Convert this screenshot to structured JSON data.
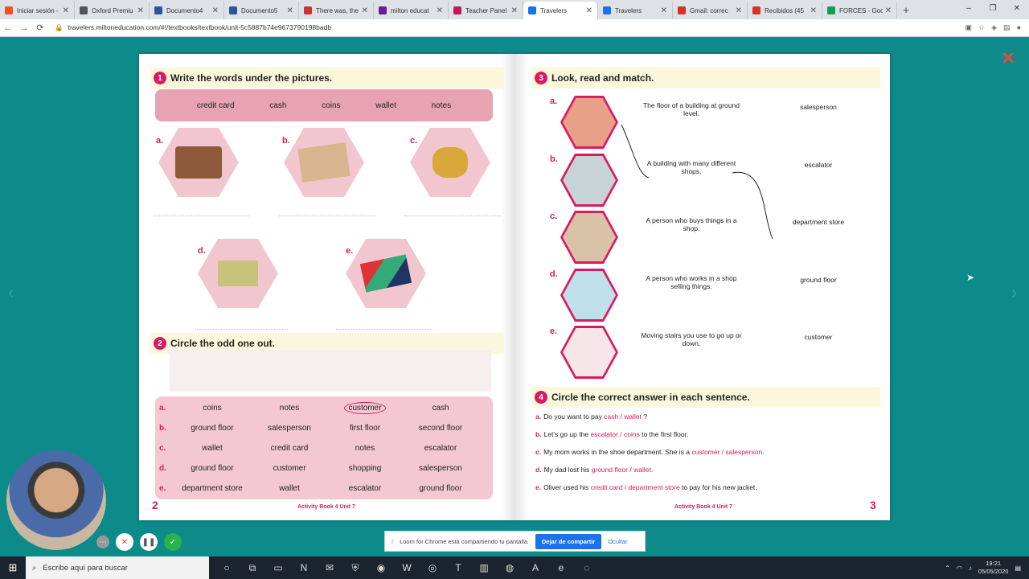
{
  "tabs": [
    {
      "title": "Iniciar sesión -",
      "color": "#f25022"
    },
    {
      "title": "Oxford Premiu",
      "color": "#555"
    },
    {
      "title": "Documento4",
      "color": "#2b579a"
    },
    {
      "title": "Documento5",
      "color": "#2b579a"
    },
    {
      "title": "There was, the",
      "color": "#c33"
    },
    {
      "title": "milton educat",
      "color": "#6a1b9a"
    },
    {
      "title": "Teacher Panel",
      "color": "#c2185b"
    },
    {
      "title": "Travelers",
      "color": "#1a73e8",
      "active": true
    },
    {
      "title": "Travelers",
      "color": "#1a73e8"
    },
    {
      "title": "Gmail: correc",
      "color": "#d93025"
    },
    {
      "title": "Recibidos (45",
      "color": "#d93025"
    },
    {
      "title": "FORCES - Goo",
      "color": "#0f9d58"
    }
  ],
  "url": "travelers.miltoneducation.com/#!/textbooks/textbook/unit-5c5887b74e9673790198badb",
  "sec1": {
    "num": "1",
    "title": "Write the words under the pictures.",
    "words": [
      "credit card",
      "cash",
      "coins",
      "wallet",
      "notes"
    ],
    "letters": [
      "a.",
      "b.",
      "c.",
      "d.",
      "e."
    ]
  },
  "sec2": {
    "num": "2",
    "title": "Circle the odd one out.",
    "rows": [
      {
        "l": "a.",
        "w": [
          "coins",
          "notes",
          "customer",
          "cash"
        ]
      },
      {
        "l": "b.",
        "w": [
          "ground floor",
          "salesperson",
          "first floor",
          "second floor"
        ]
      },
      {
        "l": "c.",
        "w": [
          "wallet",
          "credit card",
          "notes",
          "escalator"
        ]
      },
      {
        "l": "d.",
        "w": [
          "ground floor",
          "customer",
          "shopping",
          "salesperson"
        ]
      },
      {
        "l": "e.",
        "w": [
          "department store",
          "wallet",
          "escalator",
          "ground floor"
        ]
      }
    ]
  },
  "sec3": {
    "num": "3",
    "title": "Look, read and match.",
    "letters": [
      "a.",
      "b.",
      "c.",
      "d.",
      "e."
    ],
    "defs": [
      "The floor of a building at ground level.",
      "A building with many different shops.",
      "A person who buys things in a shop.",
      "A person who works in a shop selling things.",
      "Moving stairs you use to go up or down."
    ],
    "answers": [
      "salesperson",
      "escalator",
      "department store",
      "ground floor",
      "customer"
    ]
  },
  "sec4": {
    "num": "4",
    "title": "Circle the correct answer in each sentence.",
    "sentences": [
      {
        "l": "a.",
        "pre": "Do you want to pay",
        "opt": "cash / wallet",
        "post": "?"
      },
      {
        "l": "b.",
        "pre": "Let's go up the",
        "opt": "escalator / coins",
        "post": "to the first floor."
      },
      {
        "l": "c.",
        "pre": "My mom works in the shoe department. She is a",
        "opt": "customer / salesperson.",
        "post": ""
      },
      {
        "l": "d.",
        "pre": "My dad lost his",
        "opt": "ground floor / wallet.",
        "post": ""
      },
      {
        "l": "e.",
        "pre": "Oliver used his",
        "opt": "credit card / department store",
        "post": "to pay for his new jacket."
      }
    ]
  },
  "pages": {
    "left": "2",
    "right": "3",
    "footer": "Activity Book 4  Unit 7"
  },
  "loom": {
    "msg": "Loom for Chrome está compartiendo tu pantalla.",
    "stop": "Dejar de compartir",
    "hide": "Ocultar"
  },
  "taskbar": {
    "search": "Escribe aquí para buscar",
    "time": "19:21",
    "date": "05/05/2020"
  }
}
